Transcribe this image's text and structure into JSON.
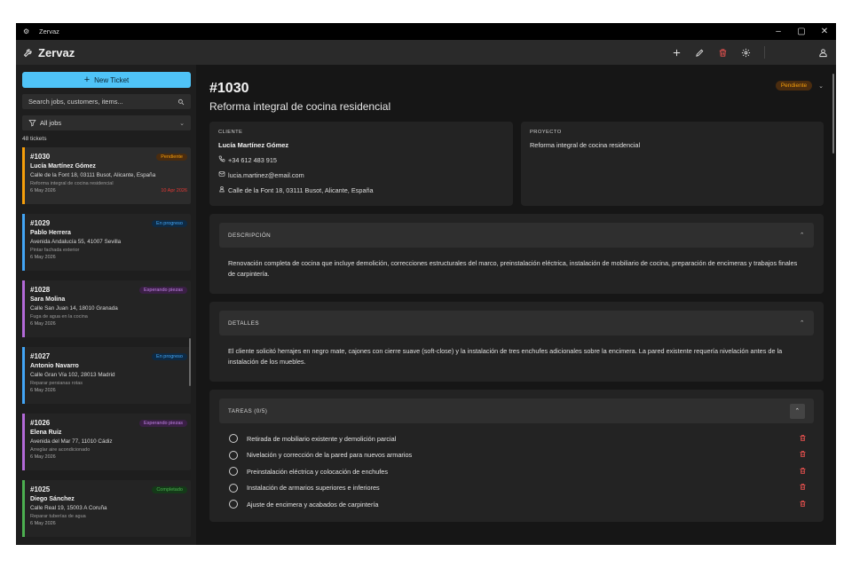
{
  "window": {
    "title": "Zervaz",
    "controls": [
      "–",
      "▢",
      "✕"
    ]
  },
  "header": {
    "brand": "Zervaz",
    "actions": [
      "plus-icon",
      "pencil-icon",
      "trash-icon",
      "gear-icon"
    ],
    "user": "user-icon"
  },
  "sidebar": {
    "new_ticket": "New Ticket",
    "search_placeholder": "Search jobs, customers, items...",
    "filter": "All jobs",
    "count": "48 tickets",
    "tickets": [
      {
        "id": "#1030",
        "status": "Pendiente",
        "status_color": "#f59e0b",
        "status_bg": "#4a2c0f",
        "bar": "#f59e0b",
        "name": "Lucía Martínez Gómez",
        "address": "Calle de la Font 18, 03111 Busot, Alicante, España",
        "desc": "Reforma integral de cocina residencial",
        "date": "6 May 2026",
        "due": "10 Apr 2026",
        "selected": true
      },
      {
        "id": "#1029",
        "status": "En progreso",
        "status_color": "#42a5f5",
        "status_bg": "#0e2a44",
        "bar": "#42a5f5",
        "name": "Pablo Herrera",
        "address": "Avenida Andalucía 55, 41007 Sevilla",
        "desc": "Pintar fachada exterior",
        "date": "6 May 2026",
        "due": ""
      },
      {
        "id": "#1028",
        "status": "Esperando piezas",
        "status_color": "#c080e6",
        "status_bg": "#3a1f45",
        "bar": "#b36ad8",
        "name": "Sara Molina",
        "address": "Calle San Juan 14, 18010 Granada",
        "desc": "Fuga de agua en la cocina",
        "date": "6 May 2026",
        "due": ""
      },
      {
        "id": "#1027",
        "status": "En progreso",
        "status_color": "#42a5f5",
        "status_bg": "#0e2a44",
        "bar": "#42a5f5",
        "name": "Antonio Navarro",
        "address": "Calle Gran Vía 102, 28013 Madrid",
        "desc": "Reparar persianas rotas",
        "date": "6 May 2026",
        "due": ""
      },
      {
        "id": "#1026",
        "status": "Esperando piezas",
        "status_color": "#c080e6",
        "status_bg": "#3a1f45",
        "bar": "#b36ad8",
        "name": "Elena Ruiz",
        "address": "Avenida del Mar 77, 11010 Cádiz",
        "desc": "Arreglar aire acondicionado",
        "date": "6 May 2026",
        "due": ""
      },
      {
        "id": "#1025",
        "status": "Completado",
        "status_color": "#4caf50",
        "status_bg": "#143a18",
        "bar": "#4caf50",
        "name": "Diego Sánchez",
        "address": "Calle Real 19, 15003 A Coruña",
        "desc": "Reparar tuberías de agua",
        "date": "6 May 2026",
        "due": ""
      }
    ]
  },
  "detail": {
    "id": "#1030",
    "title": "Reforma integral de cocina residencial",
    "status": "Pendiente",
    "client": {
      "label": "CLIENTE",
      "name": "Lucía Martínez Gómez",
      "phone": "+34 612 483 915",
      "email": "lucia.martinez@email.com",
      "address": "Calle de la Font 18, 03111 Busot, Alicante, España"
    },
    "project": {
      "label": "PROYECTO",
      "name": "Reforma integral de cocina residencial"
    },
    "description": {
      "label": "DESCRIPCIÓN",
      "text": "Renovación completa de cocina que incluye demolición, correcciones estructurales del marco, preinstalación eléctrica, instalación de mobiliario de cocina, preparación de encimeras y trabajos finales de carpintería."
    },
    "details": {
      "label": "DETALLES",
      "text": "El cliente solicitó herrajes en negro mate, cajones con cierre suave (soft-close) y la instalación de tres enchufes adicionales sobre la encimera. La pared existente requería nivelación antes de la instalación de los muebles."
    },
    "tasks": {
      "label": "TAREAS (0/5)",
      "items": [
        "Retirada de mobiliario existente y demolición parcial",
        "Nivelación y corrección de la pared para nuevos armarios",
        "Preinstalación eléctrica y colocación de enchufes",
        "Instalación de armarios superiores e inferiores",
        "Ajuste de encimera y acabados de carpintería"
      ]
    }
  }
}
